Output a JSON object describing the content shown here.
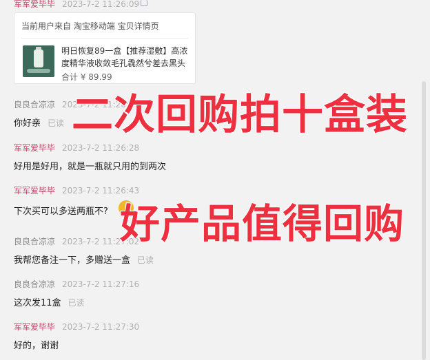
{
  "messages": [
    {
      "name": "军军爱毕毕",
      "role": "seller",
      "time": "2023-7-2 11:26:09"
    },
    {
      "name": "良良合凉凉",
      "role": "buyer",
      "time": "2023-7-2 11:26:1",
      "text": "你好亲",
      "status": "已读"
    },
    {
      "name": "军军爱毕毕",
      "role": "seller",
      "time": "2023-7-2 11:26:28",
      "text": "好用是好用，就是一瓶就只用的到两次"
    },
    {
      "name": "军军爱毕毕",
      "role": "seller",
      "time": "2023-7-2 11:26:43",
      "text": "下次买可以多送两瓶不?"
    },
    {
      "name": "良良合凉凉",
      "role": "buyer",
      "time": "2023-7-2 11:27:02",
      "text": "我帮您备注一下，多赠送一盒",
      "status": "已读"
    },
    {
      "name": "良良合凉凉",
      "role": "buyer",
      "time": "2023-7-2 11:27:16",
      "text": "这次发11盒",
      "status": "已读"
    },
    {
      "name": "军军爱毕毕",
      "role": "seller",
      "time": "2023-7-2 11:27:30",
      "text": "好的，谢谢"
    }
  ],
  "product_card": {
    "source": "当前用户来自 淘宝移动端 宝贝详情页",
    "title": "明日恢复89一盒【推荐湿敷】高浓度精华液收敛毛孔毳然兮差去黑头",
    "total_label": "合计",
    "price": "¥ 89.99"
  },
  "overlays": {
    "line1": "二次回购拍十盒装",
    "line2": "好产品值得回购"
  },
  "colors": {
    "accent_red": "#ee2f3f",
    "seller_name": "#c04b6b"
  }
}
